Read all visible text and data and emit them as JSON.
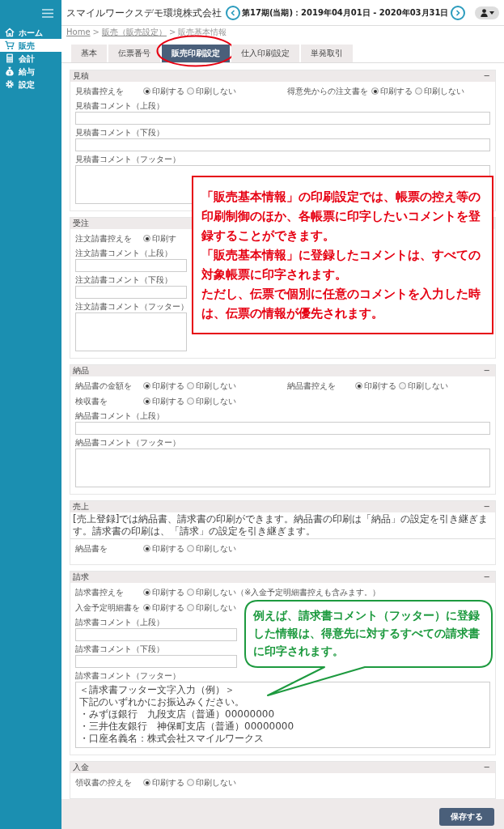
{
  "sidebar": {
    "items": [
      {
        "label": "ホーム",
        "selected": false
      },
      {
        "label": "販売",
        "selected": true
      },
      {
        "label": "会計",
        "selected": false
      },
      {
        "label": "給与",
        "selected": false
      },
      {
        "label": "設定",
        "selected": false
      }
    ]
  },
  "header": {
    "company": "スマイルワークスデモ環境株式会社",
    "period": "第17期(当期)：2019年04月01日 - 2020年03月31日"
  },
  "breadcrumb": [
    {
      "kind": "link",
      "label": "Home"
    },
    {
      "kind": "separator",
      "label": ">"
    },
    {
      "kind": "link",
      "label": "販売（販売設定）"
    },
    {
      "kind": "separator",
      "label": ">"
    },
    {
      "kind": "current",
      "label": "販売基本情報"
    }
  ],
  "tabs": [
    {
      "label": "基本",
      "selected": false,
      "circled": false
    },
    {
      "label": "伝票番号",
      "selected": false,
      "circled": false
    },
    {
      "label": "販売印刷設定",
      "selected": true,
      "circled": true
    },
    {
      "label": "仕入印刷設定",
      "selected": false,
      "circled": false
    },
    {
      "label": "単発取引",
      "selected": false,
      "circled": false
    }
  ],
  "sections": [
    {
      "title": "見積",
      "toggle": "−",
      "rows": [
        {
          "kind": "radios",
          "pairs": [
            {
              "label": "見積書控えを",
              "options": [
                {
                  "label": "印刷する",
                  "selected": true
                },
                {
                  "label": "印刷しない",
                  "selected": false
                }
              ]
            },
            {
              "label": "得意先からの注文書を",
              "options": [
                {
                  "label": "印刷する",
                  "selected": true
                },
                {
                  "label": "印刷しない",
                  "selected": false
                }
              ]
            }
          ]
        },
        {
          "kind": "field",
          "label": "見積書コメント（上段）"
        },
        {
          "kind": "field",
          "label": "見積書コメント（下段）"
        },
        {
          "kind": "textarea",
          "label": "見積書コメント（フッター）"
        }
      ]
    },
    {
      "title": "受注",
      "rows": [
        {
          "kind": "radios",
          "pairs": [
            {
              "label": "注文請書控えを",
              "options": [
                {
                  "label": "印刷す",
                  "selected": true
                }
              ]
            }
          ]
        },
        {
          "kind": "field",
          "label": "注文請書コメント（上段）"
        },
        {
          "kind": "field",
          "label": "注文請書コメント（下段）"
        },
        {
          "kind": "textarea",
          "label": "注文請書コメント（フッター）"
        }
      ],
      "callout": {
        "kind": "box",
        "paragraphs": [
          "「販売基本情報」の印刷設定では、帳票の控え等の印刷制御のほか、各帳票に印字したいコメントを登録することができます。",
          "「販売基本情報」に登録したコメントは、すべての対象帳票に印字されます。",
          "ただし、伝票で個別に任意のコメントを入力した時は、伝票の情報が優先されます。"
        ]
      }
    },
    {
      "title": "納品",
      "toggle": "−",
      "rows": [
        {
          "kind": "radios",
          "pairs": [
            {
              "label": "納品書の金額を",
              "options": [
                {
                  "label": "印刷する",
                  "selected": true
                },
                {
                  "label": "印刷しない",
                  "selected": false
                }
              ]
            },
            {
              "label": "納品書控えを",
              "options": [
                {
                  "label": "印刷する",
                  "selected": true
                },
                {
                  "label": "印刷しない",
                  "selected": false
                }
              ]
            }
          ]
        },
        {
          "kind": "radios",
          "pairs": [
            {
              "label": "検収書を",
              "options": [
                {
                  "label": "印刷する",
                  "selected": true
                },
                {
                  "label": "印刷しない",
                  "selected": false
                }
              ]
            }
          ]
        },
        {
          "kind": "field",
          "label": "納品書コメント（上段）"
        },
        {
          "kind": "textarea",
          "label": "納品書コメント（フッター）"
        }
      ]
    },
    {
      "title": "売上",
      "toggle": "−",
      "note": "[売上登録]では納品書、請求書の印刷ができます。納品書の印刷は「納品」の設定を引き継ぎます。請求書の印刷は、「請求」の設定を引き継ぎます。",
      "rows": [
        {
          "kind": "radios",
          "pairs": [
            {
              "label": "納品書を",
              "options": [
                {
                  "label": "印刷する",
                  "selected": true
                },
                {
                  "label": "印刷しない",
                  "selected": false
                }
              ]
            }
          ]
        }
      ]
    },
    {
      "title": "請求",
      "toggle": "−",
      "rows": [
        {
          "kind": "radios",
          "pairs": [
            {
              "label": "請求書控えを",
              "options": [
                {
                  "label": "印刷する",
                  "selected": true
                },
                {
                  "label": "印刷しない（※入金予定明細書控えも含みます。）",
                  "selected": false
                }
              ]
            }
          ]
        },
        {
          "kind": "radios",
          "pairs": [
            {
              "label": "入金予定明細書を",
              "options": [
                {
                  "label": "印刷する",
                  "selected": true
                },
                {
                  "label": "印刷しない",
                  "selected": false
                }
              ]
            }
          ]
        },
        {
          "kind": "field",
          "label": "請求書コメント（上段）"
        },
        {
          "kind": "field",
          "label": "請求書コメント（下段）"
        },
        {
          "kind": "textarea",
          "label": "請求書コメント（フッター）",
          "lines": [
            "＜請求書フッター文字入力（例）＞",
            "下記のいずれかにお振込みください。",
            "・みずほ銀行　九段支店（普通）00000000",
            "・三井住友銀行　神保町支店（普通）00000000",
            "・口座名義名：株式会社スマイルワークス"
          ]
        }
      ],
      "callout": {
        "kind": "bubble",
        "paragraphs": [
          "例えば、請求書コメント（フッター）に登録した情報は、得意先に対するすべての請求書に印字されます。"
        ]
      }
    },
    {
      "title": "入金",
      "toggle": "−",
      "rows": [
        {
          "kind": "radios",
          "pairs": [
            {
              "label": "領収書の控えを",
              "options": [
                {
                  "label": "印刷する",
                  "selected": true
                },
                {
                  "label": "印刷しない",
                  "selected": false
                }
              ]
            }
          ]
        }
      ]
    }
  ],
  "footer": {
    "save": "保存する"
  }
}
